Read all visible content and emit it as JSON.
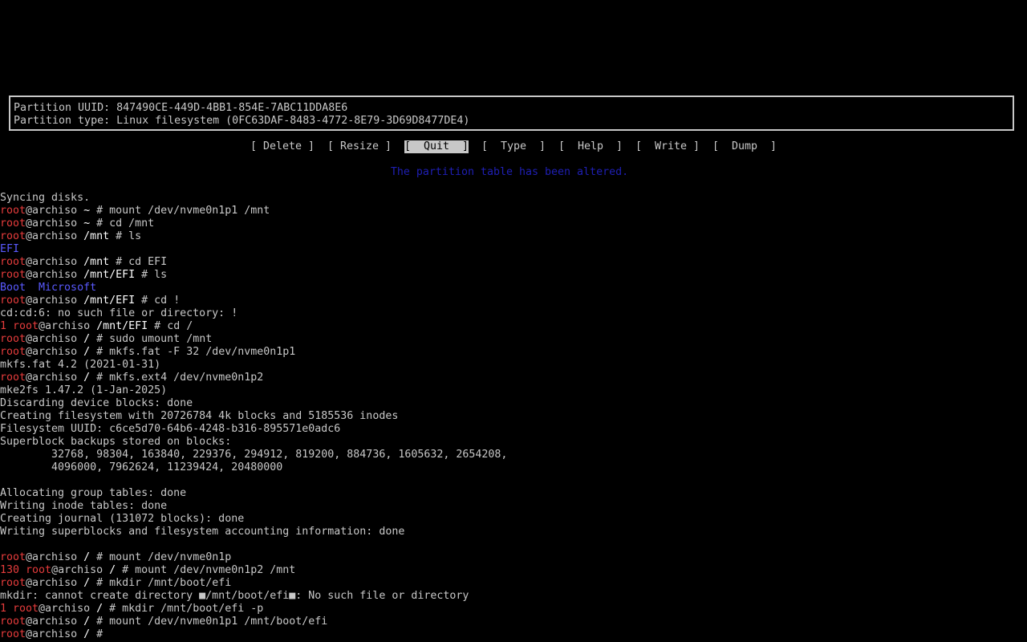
{
  "info_box": {
    "uuid_line": "Partition UUID: 847490CE-449D-4BB1-854E-7ABC11DDA8E6",
    "type_line": "Partition type: Linux filesystem (0FC63DAF-8483-4772-8E79-3D69D8477DE4)"
  },
  "menu": {
    "delete": "[ Delete ]",
    "resize": "[ Resize ]",
    "quit": "[  Quit  ]",
    "type": "[  Type  ]",
    "help": "[  Help  ]",
    "write": "[  Write ]",
    "dump": "[  Dump  ]",
    "selected": "quit"
  },
  "status_message": "The partition table has been altered.",
  "terminal": {
    "prompt_user": "root",
    "prompt_host": "@archiso",
    "lines": [
      "Syncing disks.",
      "root@archiso ~ # mount /dev/nvme0n1p1 /mnt",
      "root@archiso ~ # cd /mnt",
      "root@archiso /mnt # ls",
      "EFI",
      "root@archiso /mnt # cd EFI",
      "root@archiso /mnt/EFI # ls",
      "Boot  Microsoft",
      "root@archiso /mnt/EFI # cd !",
      "cd:cd:6: no such file or directory: !",
      "1 root@archiso /mnt/EFI # cd /",
      "root@archiso / # sudo umount /mnt",
      "root@archiso / # mkfs.fat -F 32 /dev/nvme0n1p1",
      "mkfs.fat 4.2 (2021-01-31)",
      "root@archiso / # mkfs.ext4 /dev/nvme0n1p2",
      "mke2fs 1.47.2 (1-Jan-2025)",
      "Discarding device blocks: done",
      "Creating filesystem with 20726784 4k blocks and 5185536 inodes",
      "Filesystem UUID: c6ce5d70-64b6-4248-b316-895571e0adc6",
      "Superblock backups stored on blocks:",
      "        32768, 98304, 163840, 229376, 294912, 819200, 884736, 1605632, 2654208,",
      "        4096000, 7962624, 11239424, 20480000",
      "",
      "Allocating group tables: done",
      "Writing inode tables: done",
      "Creating journal (131072 blocks): done",
      "Writing superblocks and filesystem accounting information: done",
      "",
      "root@archiso / # mount /dev/nvme0n1p",
      "130 root@archiso / # mount /dev/nvme0n1p2 /mnt",
      "root@archiso / # mkdir /mnt/boot/efi",
      "mkdir: cannot create directory ■/mnt/boot/efi■: No such file or directory",
      "1 root@archiso / # mkdir /mnt/boot/efi -p",
      "root@archiso / # mount /dev/nvme0n1p1 /mnt/boot/efi",
      "root@archiso / # "
    ]
  },
  "colors": {
    "background": "#000000",
    "text": "#c8c8c8",
    "prompt_user": "#e63c3c",
    "exit_code": "#e63c3c",
    "directory": "#5a5aff",
    "status": "#1f1fb4",
    "selected_bg": "#c8c8c8"
  }
}
